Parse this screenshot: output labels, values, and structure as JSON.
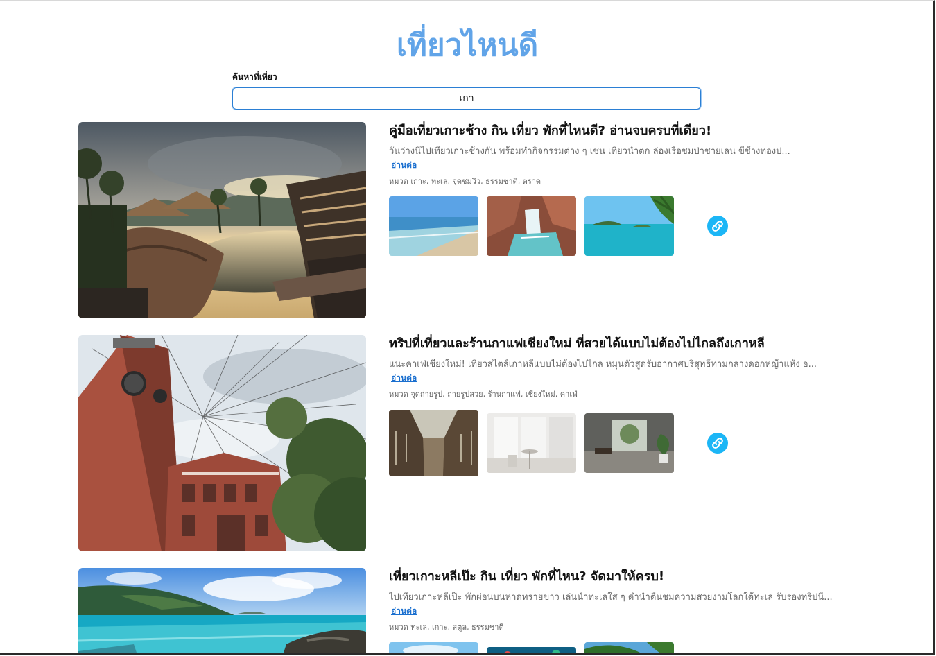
{
  "page": {
    "title": "เที่ยวไหนดี"
  },
  "search": {
    "label": "ค้นหาที่เที่ยว",
    "value": "เกา"
  },
  "cards": [
    {
      "title": "คู่มือเที่ยวเกาะช้าง กิน เที่ยว พักที่ไหนดี? อ่านจบครบที่เดียว!",
      "description": "วันว่างนี้ไปเที่ยวเกาะช้างกัน พร้อมทำกิจกรรมต่าง ๆ เช่น เที่ยวน้ำตก ล่องเรือชมป่าชายเลน ขี่ช้างท่องป...",
      "read_more": "อ่านต่อ",
      "tags": "หมวด เกาะ, ทะเล, จุดชมวิว, ธรรมชาติ, ตราด",
      "hero": "resort-pool-sunset",
      "thumbs": [
        "beach",
        "waterfall",
        "island-sea"
      ],
      "link_icon": "link-icon"
    },
    {
      "title": "ทริปที่เที่ยวและร้านกาแฟเชียงใหม่ ที่สวยได้แบบไม่ต้องไปไกลถึงเกาหลี",
      "description": "แนะคาเฟ่เชียงใหม่! เที่ยวสไตล์เกาหลีแบบไม่ต้องไปไกล หมุนตัวสูดรับอากาศบริสุทธิ์ท่ามกลางดอกหญ้าแห้ง อ...",
      "read_more": "อ่านต่อ",
      "tags": "หมวด จุดถ่ายรูป, ถ่ายรูปสวย, ร้านกาแฟ, เชียงใหม่, คาเฟ่",
      "hero": "clock-tower",
      "thumbs": [
        "arcade-hall",
        "white-cafe",
        "plant-interior"
      ],
      "link_icon": "link-icon"
    },
    {
      "title": "เที่ยวเกาะหลีเป๊ะ กิน เที่ยว พักที่ไหน? จัดมาให้ครบ!",
      "description": "ไปเที่ยวเกาะหลีเป๊ะ พักผ่อนบนหาดทรายขาว เล่นน้ำทะเลใส ๆ ดำน้ำตื้นชมความสวยงามโลกใต้ทะเล รับรองทริปนี...",
      "read_more": "อ่านต่อ",
      "tags": "หมวด ทะเล, เกาะ, สตูล, ธรรมชาติ",
      "hero": "tropical-sea",
      "thumbs": [
        "sky-beach",
        "coral",
        "palm-beach"
      ],
      "link_icon": "link-icon"
    }
  ]
}
